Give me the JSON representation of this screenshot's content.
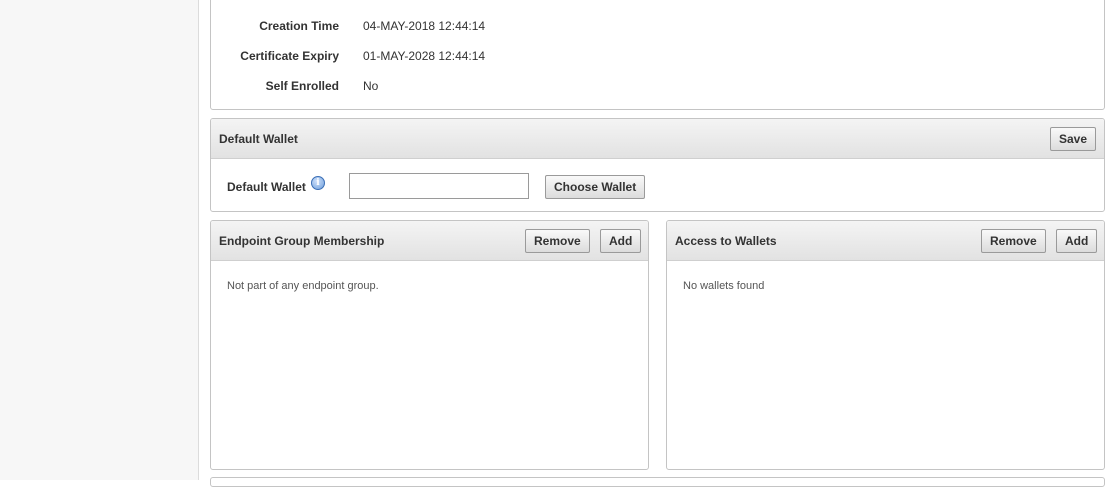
{
  "details": {
    "rows": [
      {
        "label": "Creation Time",
        "value": "04-MAY-2018 12:44:14"
      },
      {
        "label": "Certificate Expiry",
        "value": "01-MAY-2028 12:44:14"
      },
      {
        "label": "Self Enrolled",
        "value": "No"
      }
    ]
  },
  "default_wallet": {
    "title": "Default Wallet",
    "save_label": "Save",
    "field_label": "Default Wallet",
    "field_value": "",
    "choose_label": "Choose Wallet"
  },
  "endpoint_group": {
    "title": "Endpoint Group Membership",
    "remove_label": "Remove",
    "add_label": "Add",
    "empty_text": "Not part of any endpoint group."
  },
  "wallet_access": {
    "title": "Access to Wallets",
    "remove_label": "Remove",
    "add_label": "Add",
    "empty_text": "No wallets found"
  }
}
